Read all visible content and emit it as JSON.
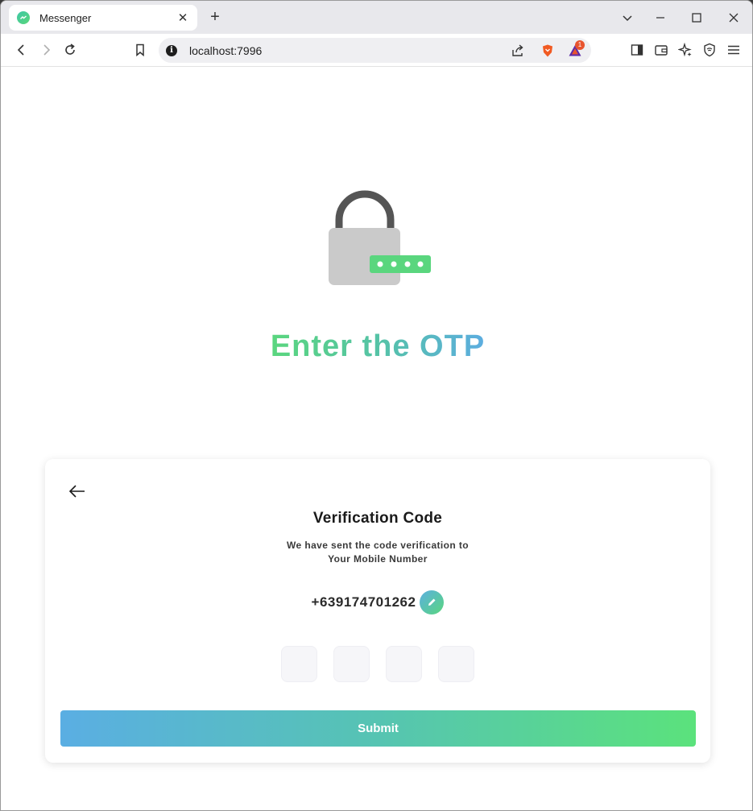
{
  "browser": {
    "tab_title": "Messenger",
    "tab_close": "✕",
    "new_tab": "+",
    "url": "localhost:7996",
    "info_glyph": "i",
    "notification_count": "1"
  },
  "page": {
    "heading": "Enter the OTP",
    "card": {
      "title": "Verification Code",
      "subtitle_line1": "We have sent the code verification to",
      "subtitle_line2": "Your Mobile Number",
      "phone": "+639174701262",
      "otp_boxes": [
        "",
        "",
        "",
        ""
      ],
      "submit_label": "Submit"
    }
  },
  "colors": {
    "accent_green": "#5ad67e",
    "accent_blue": "#5cade0",
    "lock_body": "#cacaca",
    "lock_shackle": "#555555"
  }
}
